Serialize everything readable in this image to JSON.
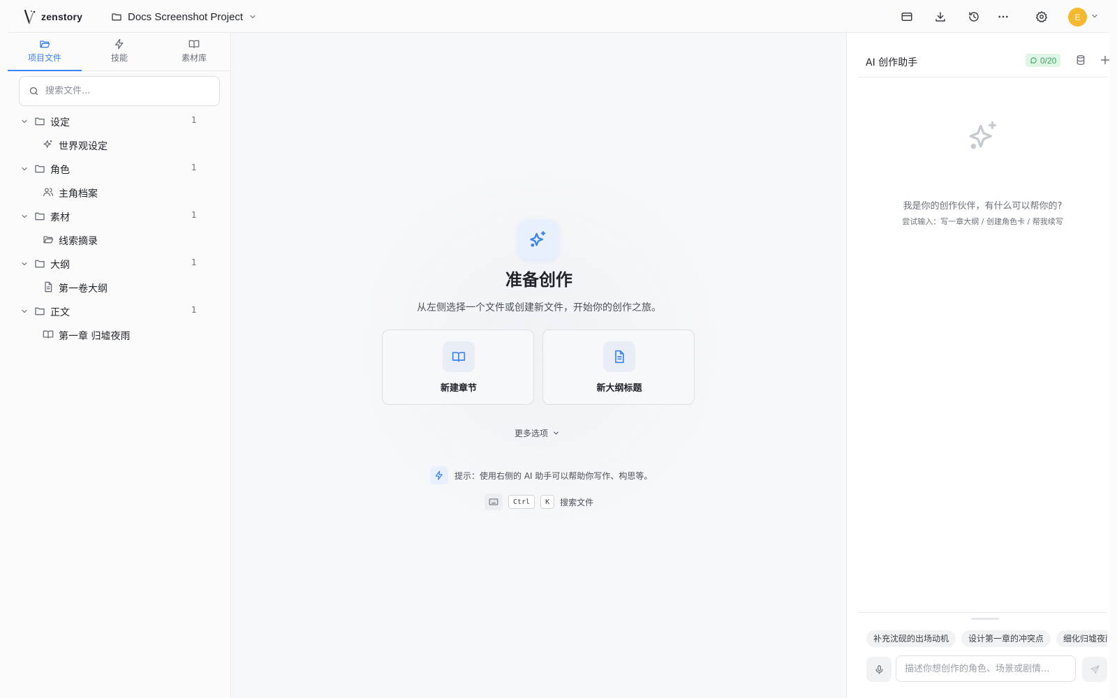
{
  "header": {
    "logo_text": "zenstory",
    "project_name": "Docs Screenshot Project",
    "avatar_letter": "E",
    "icons": [
      "layout-icon",
      "download-icon",
      "history-icon",
      "more-icon",
      "settings-icon"
    ]
  },
  "sidebar": {
    "tabs": [
      {
        "label": "项目文件",
        "icon": "folder-open-icon",
        "active": true
      },
      {
        "label": "技能",
        "icon": "lightning-icon",
        "active": false
      },
      {
        "label": "素材库",
        "icon": "book-icon",
        "active": false
      }
    ],
    "search_placeholder": "搜索文件...",
    "folders": [
      {
        "label": "设定",
        "count": "1",
        "children": [
          {
            "label": "世界观设定",
            "icon": "sparkles-icon"
          }
        ]
      },
      {
        "label": "角色",
        "count": "1",
        "children": [
          {
            "label": "主角档案",
            "icon": "users-icon"
          }
        ]
      },
      {
        "label": "素材",
        "count": "1",
        "children": [
          {
            "label": "线索摘录",
            "icon": "folder-open-icon"
          }
        ]
      },
      {
        "label": "大纲",
        "count": "1",
        "children": [
          {
            "label": "第一卷大纲",
            "icon": "document-icon"
          }
        ]
      },
      {
        "label": "正文",
        "count": "1",
        "children": [
          {
            "label": "第一章 归墟夜雨",
            "icon": "book-icon"
          }
        ]
      }
    ]
  },
  "main": {
    "title": "准备创作",
    "subtitle": "从左侧选择一个文件或创建新文件，开始你的创作之旅。",
    "cards": [
      {
        "label": "新建章节",
        "icon": "book-icon"
      },
      {
        "label": "新大纲标题",
        "icon": "document-icon"
      }
    ],
    "more_options": "更多选项",
    "tip": "提示：使用右侧的 AI 助手可以帮助你写作、构思等。",
    "shortcut": {
      "key1": "Ctrl",
      "key2": "K",
      "label": "搜索文件"
    }
  },
  "assistant": {
    "title": "AI 创作助手",
    "usage": "0/20",
    "empty_title": "我是你的创作伙伴，有什么可以帮你的?",
    "empty_hint": "尝试输入：写一章大纲 / 创建角色卡 / 帮我续写",
    "suggestions": [
      "补充沈砚的出场动机",
      "设计第一章的冲突点",
      "细化归墟夜雨"
    ],
    "input_placeholder": "描述你想创作的角色、场景或剧情..."
  },
  "colors": {
    "accent": "#3b82f6",
    "avatar": "#f5b82e",
    "badge_bg": "#dff5e6",
    "badge_text": "#2fa85a"
  }
}
